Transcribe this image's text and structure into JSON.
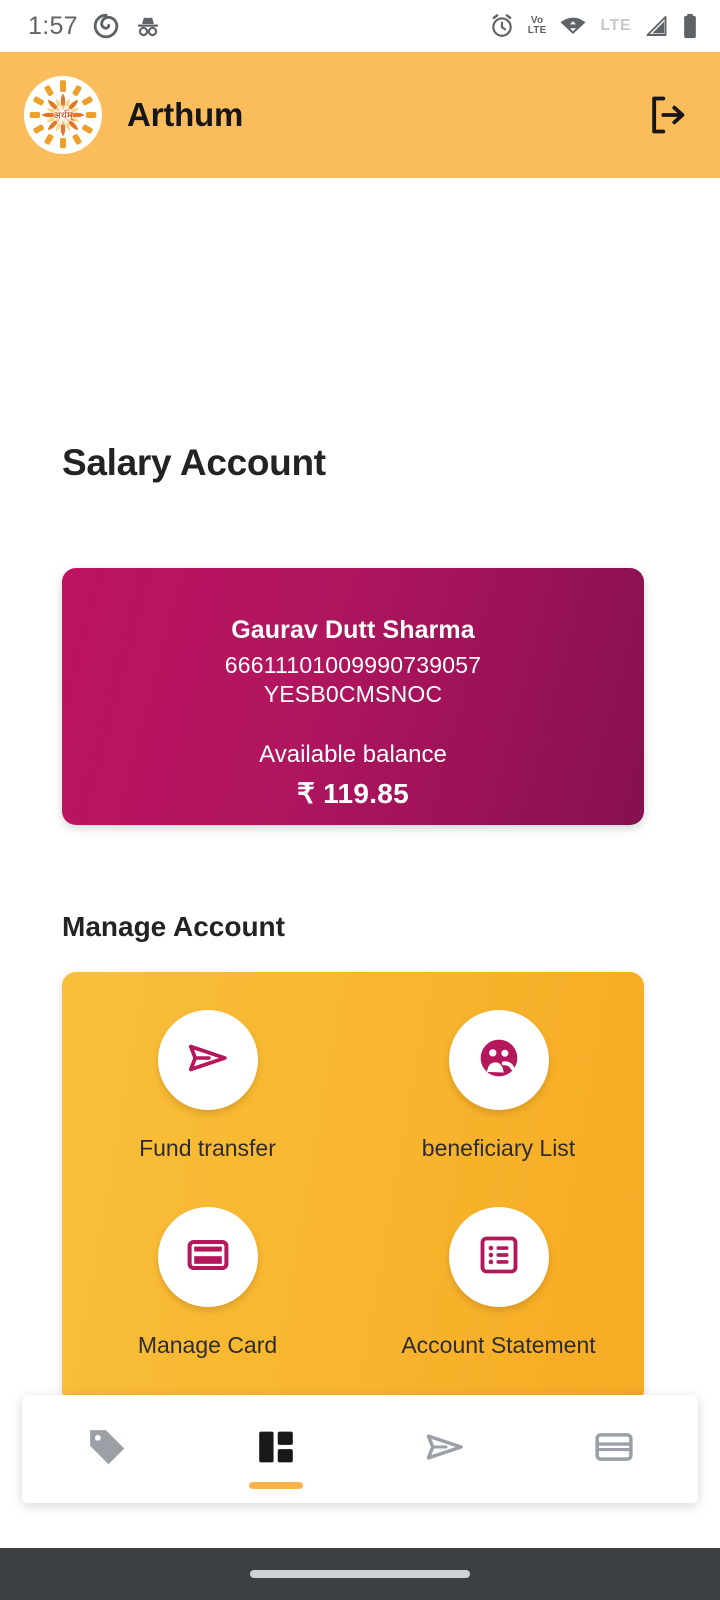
{
  "status_bar": {
    "time": "1:57",
    "left_icons": [
      "spiral-icon",
      "incognito-icon"
    ],
    "right_icons": [
      "alarm-icon",
      "volte-icon",
      "wifi-icon",
      "lte-icon",
      "signal-icon",
      "battery-icon"
    ],
    "volte_top": "Vo",
    "volte_bottom": "LTE",
    "lte_label": "LTE"
  },
  "appbar": {
    "app_name": "Arthum",
    "logo_text": "अर्थम्",
    "logo_name": "arthum-lotus-logo",
    "logout_name": "logout-icon",
    "background": "#fbbc5c"
  },
  "page": {
    "title": "Salary Account"
  },
  "account_card": {
    "holder_name": "Gaurav Dutt Sharma",
    "account_number": "66611101009990739057",
    "ifsc": "YESB0CMSNOC",
    "balance_label": "Available balance",
    "balance_amount": "₹ 119.85",
    "gradient_from": "#bd1260",
    "gradient_to": "#861050"
  },
  "manage_account": {
    "heading": "Manage Account",
    "panel_color_from": "#f9bf3b",
    "panel_color_to": "#f6ab24",
    "icon_color": "#b5175d",
    "tiles": [
      {
        "label": "Fund transfer",
        "icon": "send-icon"
      },
      {
        "label": "beneficiary List",
        "icon": "group-people-icon"
      },
      {
        "label": "Manage Card",
        "icon": "credit-card-icon"
      },
      {
        "label": "Account Statement",
        "icon": "list-statement-icon"
      }
    ]
  },
  "bottom_nav": {
    "active_index": 1,
    "active_color": "#f9b348",
    "items": [
      {
        "icon": "tag-icon",
        "active": false
      },
      {
        "icon": "dashboard-grid-icon",
        "active": true
      },
      {
        "icon": "send-icon",
        "active": false
      },
      {
        "icon": "card-icon",
        "active": false
      }
    ]
  }
}
